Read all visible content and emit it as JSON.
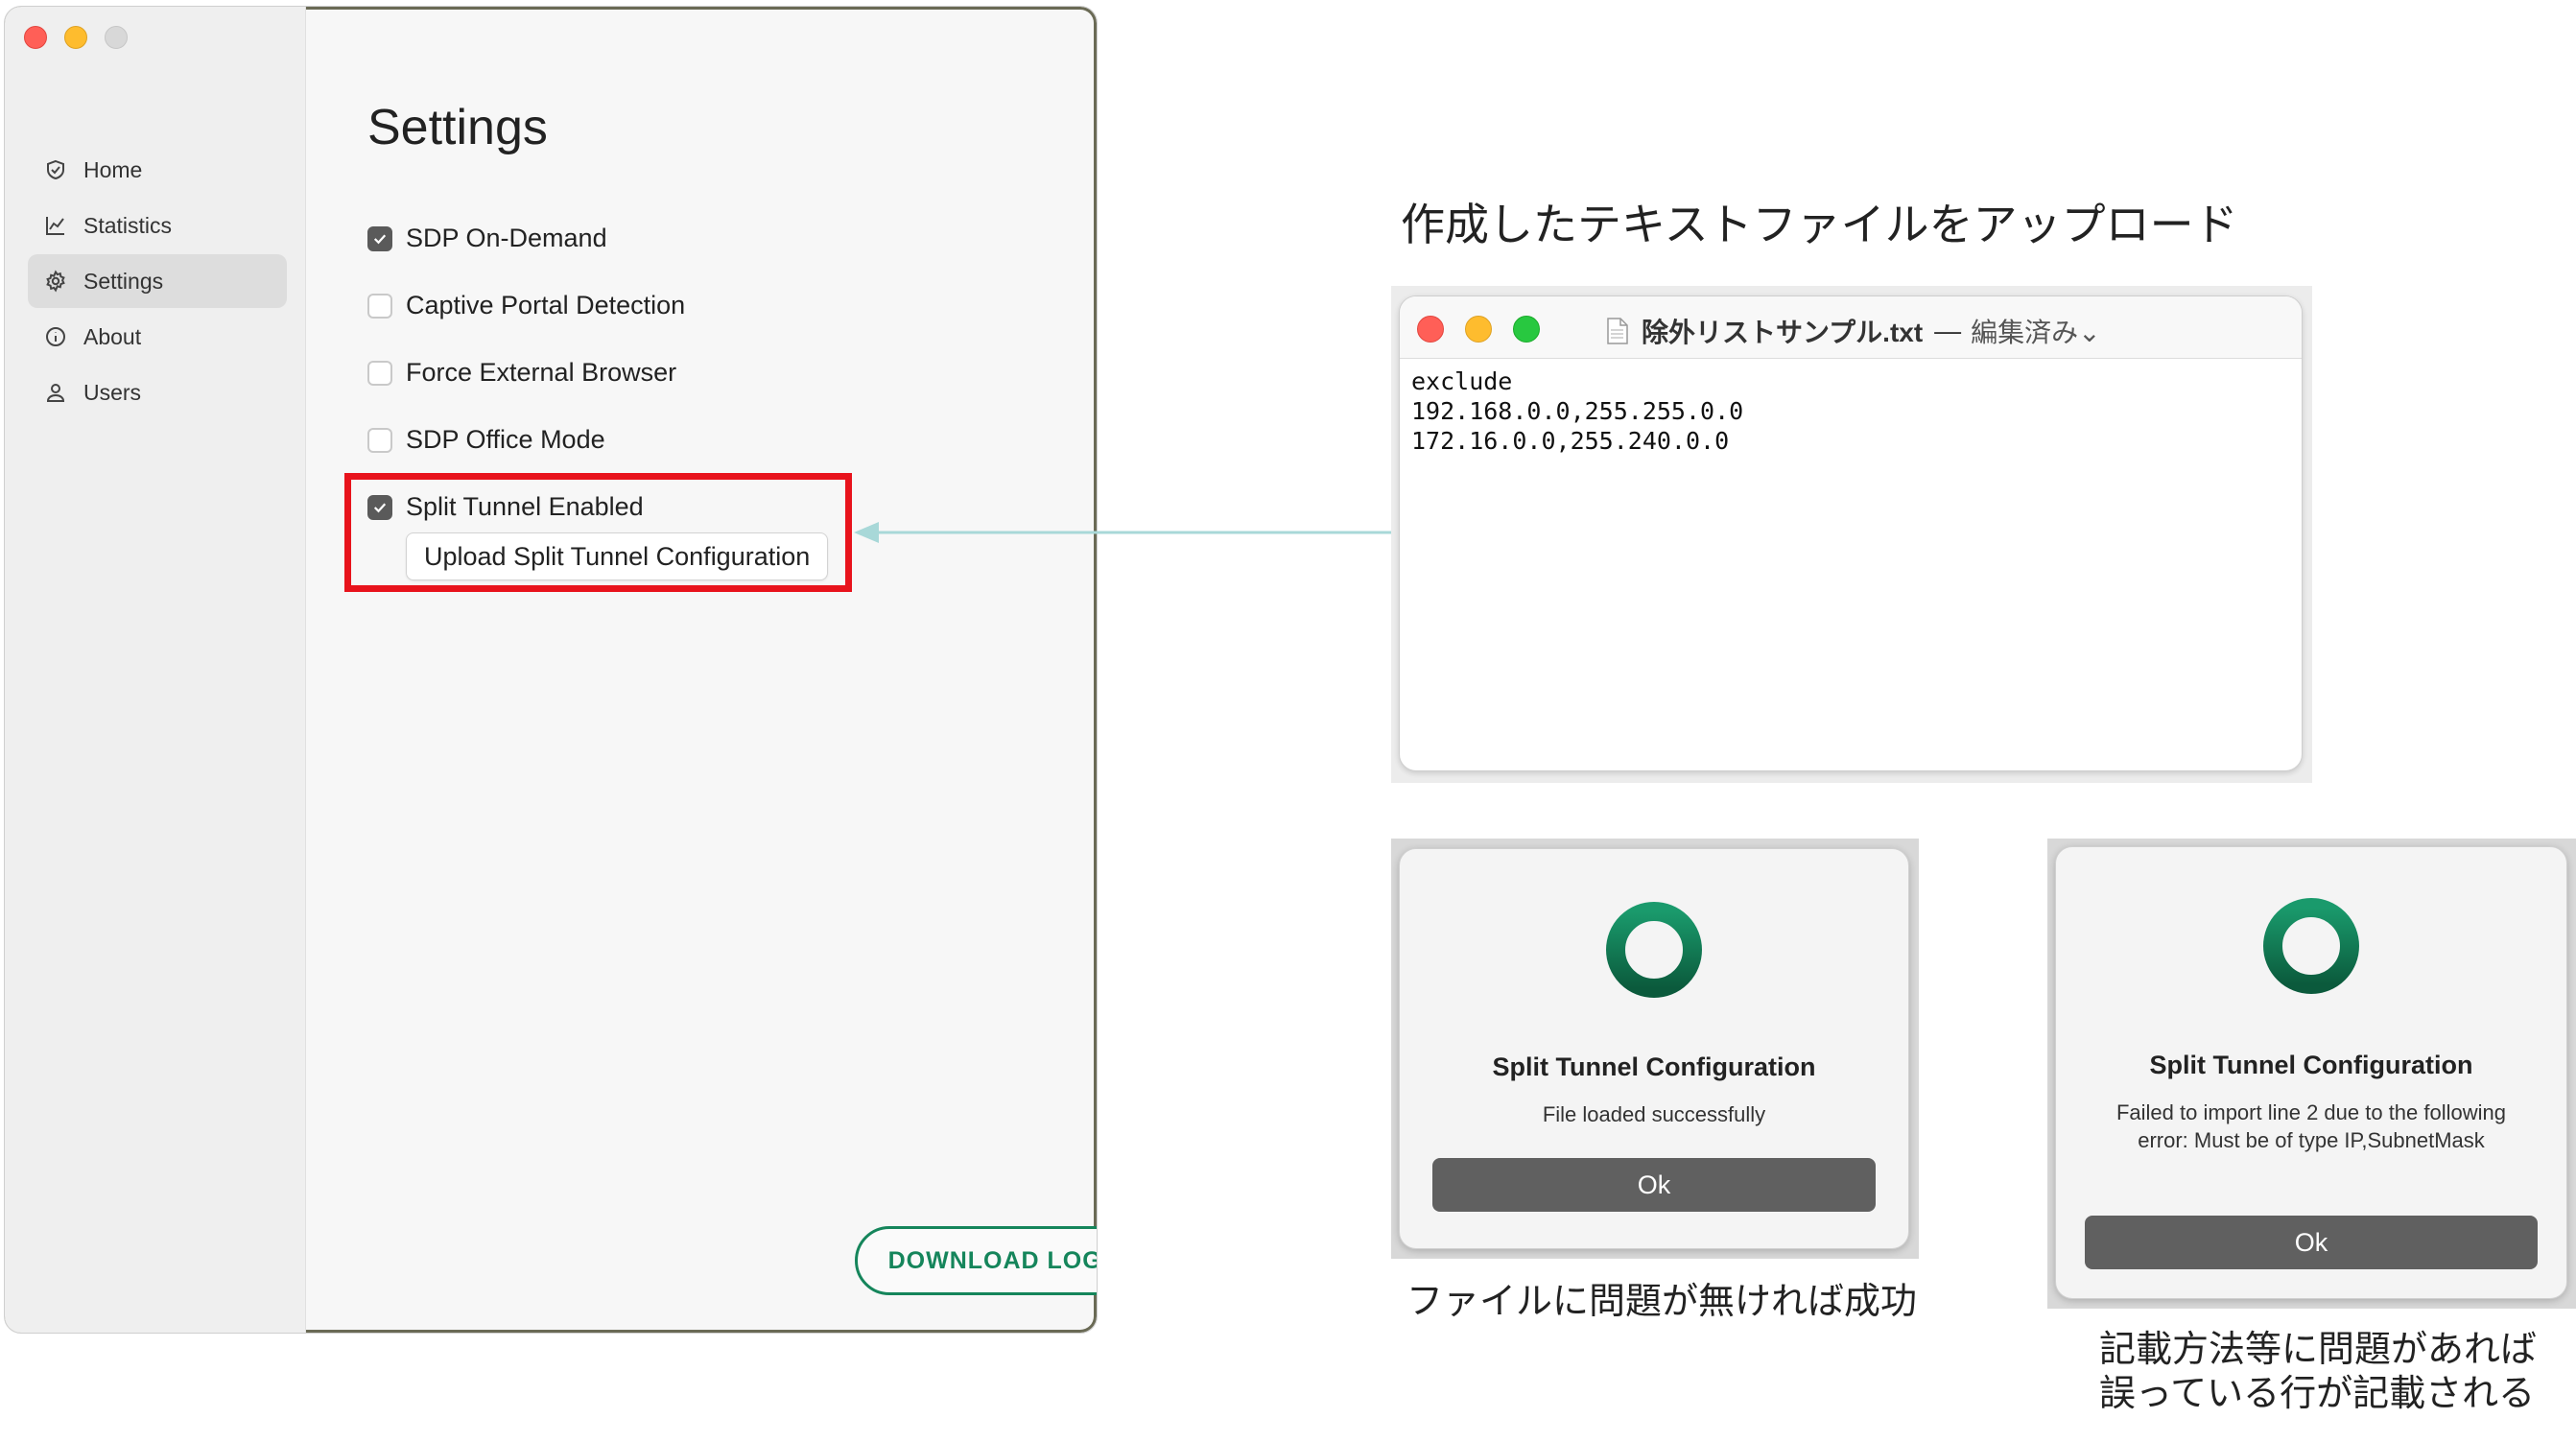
{
  "settings_window": {
    "sidebar": {
      "items": [
        {
          "label": "Home",
          "icon": "shield-check-icon",
          "active": false
        },
        {
          "label": "Statistics",
          "icon": "chart-line-icon",
          "active": false
        },
        {
          "label": "Settings",
          "icon": "gear-icon",
          "active": true
        },
        {
          "label": "About",
          "icon": "info-icon",
          "active": false
        },
        {
          "label": "Users",
          "icon": "user-icon",
          "active": false
        }
      ]
    },
    "title": "Settings",
    "options": [
      {
        "label": "SDP On-Demand",
        "checked": true
      },
      {
        "label": "Captive Portal Detection",
        "checked": false
      },
      {
        "label": "Force External Browser",
        "checked": false
      },
      {
        "label": "SDP Office Mode",
        "checked": false
      },
      {
        "label": "Split Tunnel Enabled",
        "checked": true
      }
    ],
    "upload_button": "Upload Split Tunnel Configuration",
    "download_logs": "DOWNLOAD LOGS",
    "highlight_color": "#e8131c",
    "accent_color": "#15855b"
  },
  "headline": "作成したテキストファイルをアップロード",
  "editor": {
    "filename": "除外リストサンプル.txt",
    "separator": "—",
    "status": "編集済み⌄",
    "lines": [
      "exclude",
      "192.168.0.0,255.255.0.0",
      "172.16.0.0,255.240.0.0"
    ]
  },
  "dialog_success": {
    "title": "Split Tunnel Configuration",
    "message": "File loaded successfully",
    "ok": "Ok",
    "caption": "ファイルに問題が無ければ成功"
  },
  "dialog_error": {
    "title": "Split Tunnel Configuration",
    "message": "Failed to import line 2 due to the following error: Must be of type IP,SubnetMask",
    "ok": "Ok",
    "caption_line1": "記載方法等に問題があれば",
    "caption_line2": "誤っている行が記載される"
  }
}
